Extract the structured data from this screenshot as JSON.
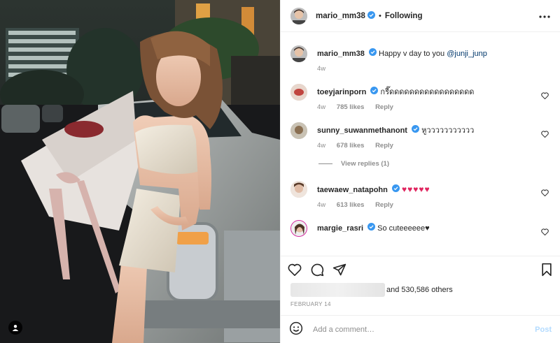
{
  "header": {
    "username": "mario_mm38",
    "separator": "•",
    "follow_state": "Following"
  },
  "caption": {
    "username": "mario_mm38",
    "text": "Happy v day to you",
    "mention": "@junji_junp",
    "time": "4w"
  },
  "comments": [
    {
      "username": "toeyjarinporn",
      "text": "กรี๊ดดดดดดดดดดดดดดดดด",
      "time": "4w",
      "likes": "785 likes",
      "reply": "Reply"
    },
    {
      "username": "sunny_suwanmethanont",
      "text": "หูววววววววววว",
      "time": "4w",
      "likes": "678 likes",
      "reply": "Reply",
      "view_replies": "View replies (1)"
    },
    {
      "username": "taewaew_natapohn",
      "text": "♥♥♥♥♥",
      "time": "4w",
      "likes": "613 likes",
      "reply": "Reply"
    },
    {
      "username": "margie_rasri",
      "text": "So cuteeeeee♥"
    }
  ],
  "likes": {
    "text": "and 530,586 others"
  },
  "date": "FEBRUARY 14",
  "add_comment": {
    "placeholder": "Add a comment…",
    "post_label": "Post"
  },
  "icons": {
    "more": "more-options-icon",
    "heart": "heart-icon",
    "comment": "comment-icon",
    "share": "share-icon",
    "bookmark": "bookmark-icon",
    "emoji": "emoji-icon",
    "verified": "verified-badge-icon",
    "user_tag": "user-tag-icon"
  },
  "colors": {
    "verified_blue": "#3897f0",
    "link": "#00376b",
    "muted": "#8e8e8e",
    "post_disabled": "#b3dbff",
    "heart_red": "#e0245e"
  }
}
